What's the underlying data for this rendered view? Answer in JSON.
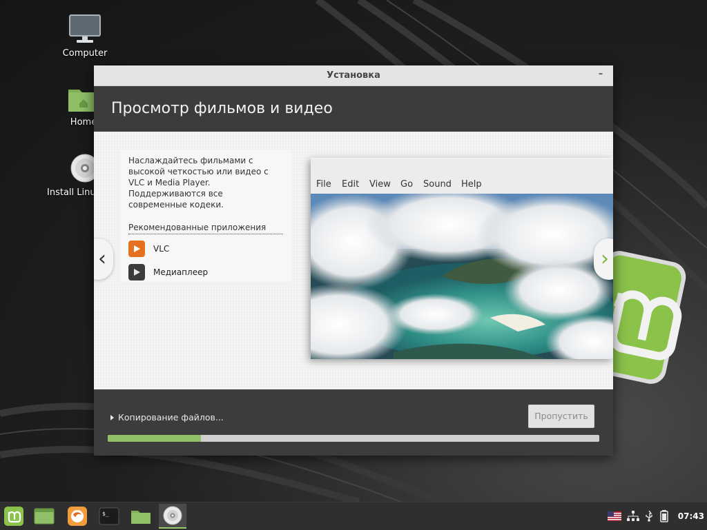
{
  "desktop": {
    "icons": [
      {
        "label": "Computer",
        "icon": "computer-icon"
      },
      {
        "label": "Home",
        "icon": "home-folder-icon"
      },
      {
        "label": "Install Linux Mint",
        "icon": "disc-icon"
      }
    ]
  },
  "window": {
    "title": "Установка",
    "minimize_glyph": "–",
    "header": "Просмотр фильмов и видео",
    "description": "Наслаждайтесь фильмами с высокой четкостью или видео с VLC и Media Player. Поддерживаются все современные кодеки.",
    "recommended_title": "Рекомендованные приложения",
    "apps": [
      {
        "name": "VLC",
        "icon": "vlc-play-icon",
        "color": "#e5701d"
      },
      {
        "name": "Медиаплеер",
        "icon": "media-player-play-icon",
        "color": "#3c3c3c"
      }
    ],
    "screenshot_menu": [
      "File",
      "Edit",
      "View",
      "Go",
      "Sound",
      "Help"
    ],
    "nav_prev_glyph": "‹",
    "nav_next_glyph": "›",
    "status": "Копирование файлов...",
    "skip_label": "Пропустить",
    "progress_fraction": 0.19
  },
  "taskbar": {
    "items": [
      {
        "icon": "mint-menu-icon"
      },
      {
        "icon": "show-desktop-icon"
      },
      {
        "icon": "firefox-icon"
      },
      {
        "icon": "terminal-icon",
        "glyph": "$_"
      },
      {
        "icon": "files-icon"
      },
      {
        "icon": "installer-disc-icon"
      }
    ],
    "tray": [
      "us-flag-icon",
      "network-icon",
      "usb-icon",
      "battery-icon"
    ],
    "clock": "07:43"
  },
  "colors": {
    "accent": "#8fbf67",
    "header_bg": "#3c3c3c",
    "next_arrow": "#7cb342"
  }
}
